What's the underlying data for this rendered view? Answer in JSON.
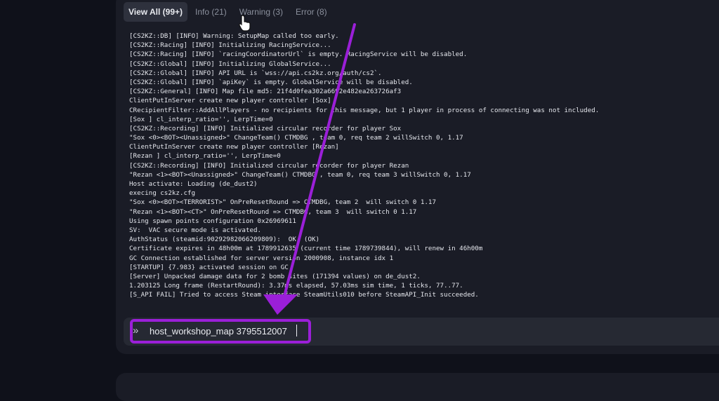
{
  "tabs": [
    {
      "label": "View All (99+)",
      "active": true
    },
    {
      "label": "Info (21)",
      "active": false
    },
    {
      "label": "Warning (3)",
      "active": false
    },
    {
      "label": "Error (8)",
      "active": false
    }
  ],
  "log_lines": [
    "[CS2KZ::DB] [INFO] Warning: SetupMap called too early.",
    "[CS2KZ::Racing] [INFO] Initializing RacingService...",
    "[CS2KZ::Racing] [INFO] `racingCoordinatorUrl` is empty. RacingService will be disabled.",
    "[CS2KZ::Global] [INFO] Initializing GlobalService...",
    "[CS2KZ::Global] [INFO] API URL is `wss://api.cs2kz.org/auth/cs2`.",
    "[CS2KZ::Global] [INFO] `apiKey` is empty. GlobalService will be disabled.",
    "[CS2KZ::General] [INFO] Map file md5: 21f4d0fea302a6692e482ea263726af3",
    "ClientPutInServer create new player controller [Sox]",
    "CRecipientFilter::AddAllPlayers - no recipients for this message, but 1 player in process of connecting was not included.",
    "[Sox ] cl_interp_ratio='', LerpTime=0",
    "[CS2KZ::Recording] [INFO] Initialized circular recorder for player Sox",
    "\"Sox <0><BOT><Unassigned>\" ChangeTeam() CTMDBG , team 0, req team 2 willSwitch 0, 1.17",
    "ClientPutInServer create new player controller [Rezan]",
    "[Rezan ] cl_interp_ratio='', LerpTime=0",
    "[CS2KZ::Recording] [INFO] Initialized circular recorder for player Rezan",
    "\"Rezan <1><BOT><Unassigned>\" ChangeTeam() CTMDBG , team 0, req team 3 willSwitch 0, 1.17",
    "Host activate: Loading (de_dust2)",
    "execing cs2kz.cfg",
    "\"Sox <0><BOT><TERRORIST>\" OnPreResetRound => CTMDBG, team 2  will switch 0 1.17",
    "\"Rezan <1><BOT><CT>\" OnPreResetRound => CTMDBG, team 3  will switch 0 1.17",
    "Using spawn points configuration 0x26969611",
    "SV:  VAC secure mode is activated.",
    "AuthStatus (steamid:90292982066209809):  OK  (OK)",
    "Certificate expires in 48h00m at 1789912635 (current time 1789739844), will renew in 46h00m",
    "GC Connection established for server version 2000908, instance idx 1",
    "[STARTUP] {7.983} activated session on GC",
    "[Server] Unpacked damage data for 2 bomb sites (171394 values) on de_dust2.",
    "1.203125 Long frame (RestartRound): 3.37ms elapsed, 57.03ms sim time, 1 ticks, 77..77.",
    "[S_API FAIL] Tried to access Steam interface SteamUtils010 before SteamAPI_Init succeeded."
  ],
  "command": {
    "prompt_icon": "»",
    "value": "host_workshop_map 3795512007"
  },
  "annotation": {
    "color": "#9b1fd8",
    "type": "arrow-and-box"
  },
  "cursor": {
    "icon": "hand-pointer-icon"
  }
}
